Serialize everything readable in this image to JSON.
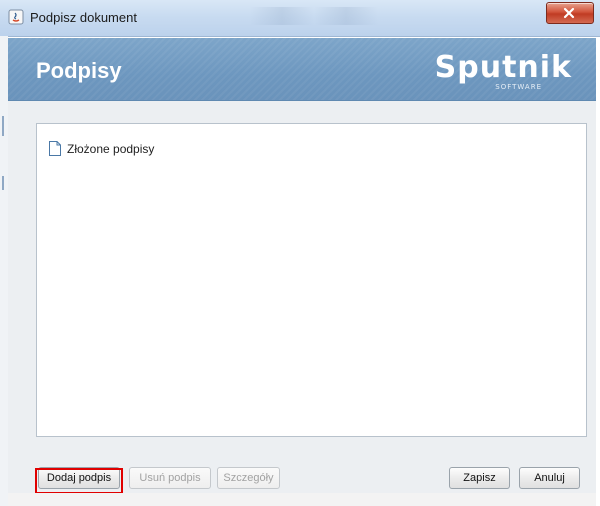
{
  "window": {
    "title": "Podpisz dokument",
    "close_label": "x"
  },
  "banner": {
    "heading": "Podpisy",
    "logo_text": "Sputnik",
    "logo_sub": "SOFTWARE"
  },
  "tree": {
    "items": [
      {
        "label": "Złożone podpisy",
        "icon": "document-icon"
      }
    ]
  },
  "buttons": {
    "add": "Dodaj podpis",
    "remove": "Usuń podpis",
    "details": "Szczegóły",
    "save": "Zapisz",
    "cancel": "Anuluj"
  },
  "colors": {
    "banner": "#6d97bf",
    "highlight": "#e00000"
  }
}
